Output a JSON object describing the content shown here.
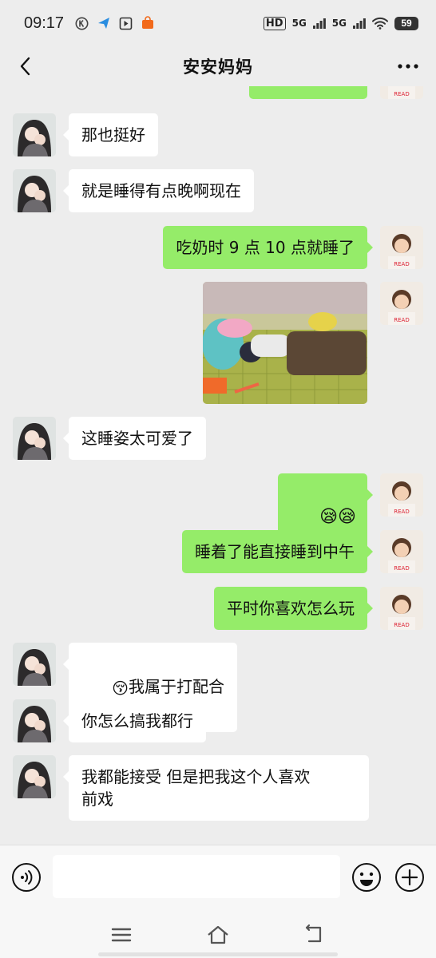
{
  "status_bar": {
    "time": "09:17",
    "left_icons": [
      "k-circle-icon",
      "paper-plane-icon",
      "play-box-icon",
      "shopping-bag-icon"
    ],
    "network_label_1": "HD",
    "network_label_2": "5G",
    "network_label_3": "5G",
    "battery": "59"
  },
  "header": {
    "title": "安安妈妈",
    "back_icon": "chevron-left-icon",
    "more_icon": "more-dots-icon"
  },
  "messages": [
    {
      "side": "left",
      "type": "text",
      "text": "那也挺好"
    },
    {
      "side": "left",
      "type": "text",
      "text": "就是睡得有点晚啊现在"
    },
    {
      "side": "right",
      "type": "text",
      "text": "吃奶时 9 点 10 点就睡了"
    },
    {
      "side": "right",
      "type": "image",
      "description_icon": "sleeping-child-photo"
    },
    {
      "side": "left",
      "type": "text",
      "text": "这睡姿太可爱了"
    },
    {
      "side": "right",
      "type": "emoji",
      "emoji": "😪😪"
    },
    {
      "side": "right",
      "type": "text",
      "text": "睡着了能直接睡到中午"
    },
    {
      "side": "right",
      "type": "text",
      "text": "平时你喜欢怎么玩"
    },
    {
      "side": "left",
      "type": "text",
      "emoji": "😚",
      "text": "我属于打配合"
    },
    {
      "side": "left",
      "type": "text",
      "text": "你怎么搞我都行"
    },
    {
      "side": "left",
      "type": "text",
      "text": "我都能接受 但是把我这个人喜欢\n前戏"
    }
  ],
  "input_bar": {
    "value": "",
    "placeholder": "",
    "voice_icon": "voice-icon",
    "emoji_icon": "smiley-icon",
    "plus_icon": "plus-circle-icon"
  },
  "system_nav": {
    "menu_icon": "menu-lines-icon",
    "home_icon": "home-icon",
    "back_icon": "return-icon"
  },
  "colors": {
    "background": "#ededed",
    "sent_bubble": "#95ec69",
    "received_bubble": "#ffffff"
  }
}
